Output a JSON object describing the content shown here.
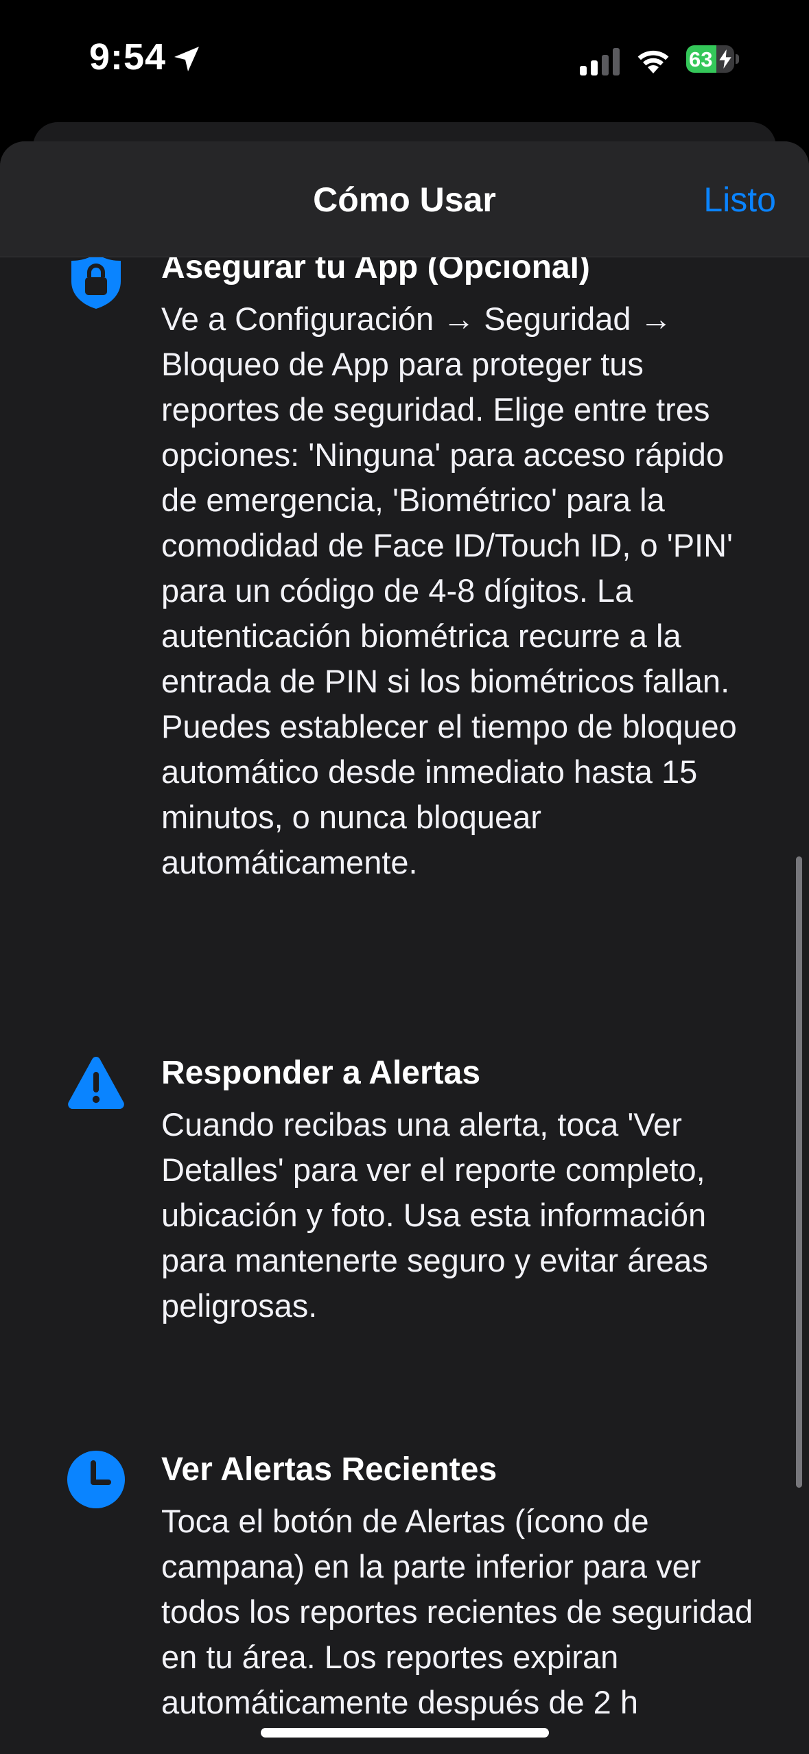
{
  "status_bar": {
    "time": "9:54",
    "battery_level": "63",
    "battery_fraction": 0.63,
    "charging": true,
    "icons": [
      "location-arrow-icon",
      "cellular-signal-icon",
      "wifi-icon",
      "battery-icon",
      "charging-bolt-icon"
    ]
  },
  "nav": {
    "title": "Cómo Usar",
    "done_label": "Listo"
  },
  "sections": [
    {
      "icon": "shield-lock-icon",
      "title": "Asegurar tu App (Opcional)",
      "body": "Ve a Configuración → Seguridad → Bloqueo de App para proteger tus reportes de seguridad. Elige entre tres opciones: 'Ninguna' para acceso rápido de emergencia, 'Biométrico' para la comodidad de Face ID/Touch ID, o 'PIN' para un código de 4-8 dígitos. La autenticación biométrica recurre a la entrada de PIN si los biométricos fallan. Puedes establecer el tiempo de bloqueo automático desde inmediato hasta 15 minutos, o nunca bloquear automáticamente."
    },
    {
      "icon": "warning-triangle-icon",
      "title": "Responder a Alertas",
      "body": "Cuando recibas una alerta, toca 'Ver Detalles' para ver el reporte completo, ubicación y foto. Usa esta información para mantenerte seguro y evitar áreas peligrosas."
    },
    {
      "icon": "clock-icon",
      "title": "Ver Alertas Recientes",
      "body": "Toca el botón de Alertas (ícono de campana) en la parte inferior para ver todos los reportes recientes de seguridad en tu área. Los reportes expiran automáticamente después de 2 h"
    }
  ],
  "colors": {
    "accent": "#0a84ff",
    "sheet_background": "#1c1c1e",
    "nav_background": "#262628",
    "battery_green": "#34c759"
  }
}
